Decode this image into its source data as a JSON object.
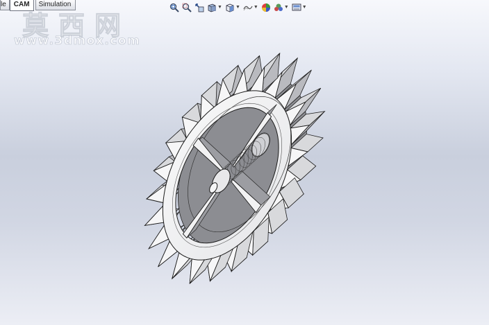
{
  "tabs": [
    {
      "label": "le",
      "state": "partial"
    },
    {
      "label": "CAM",
      "state": "active"
    },
    {
      "label": "Simulation",
      "state": "normal"
    }
  ],
  "toolbar": {
    "icons": [
      "zoom-to-fit-icon",
      "zoom-to-area-icon",
      "previous-view-icon",
      "section-view-icon",
      "view-orientation-icon",
      "display-style-icon",
      "hide-show-items-icon",
      "edit-appearance-icon",
      "apply-scene-icon",
      "view-settings-icon"
    ]
  },
  "watermark": {
    "title": "莫西网",
    "url": "www.3dmox.com"
  },
  "viewport": {
    "model": "sprocket-gear",
    "tooth_count": 24,
    "spoke_count": 4,
    "background_top": "#f7f8fc",
    "background_mid": "#c9cfdd"
  }
}
